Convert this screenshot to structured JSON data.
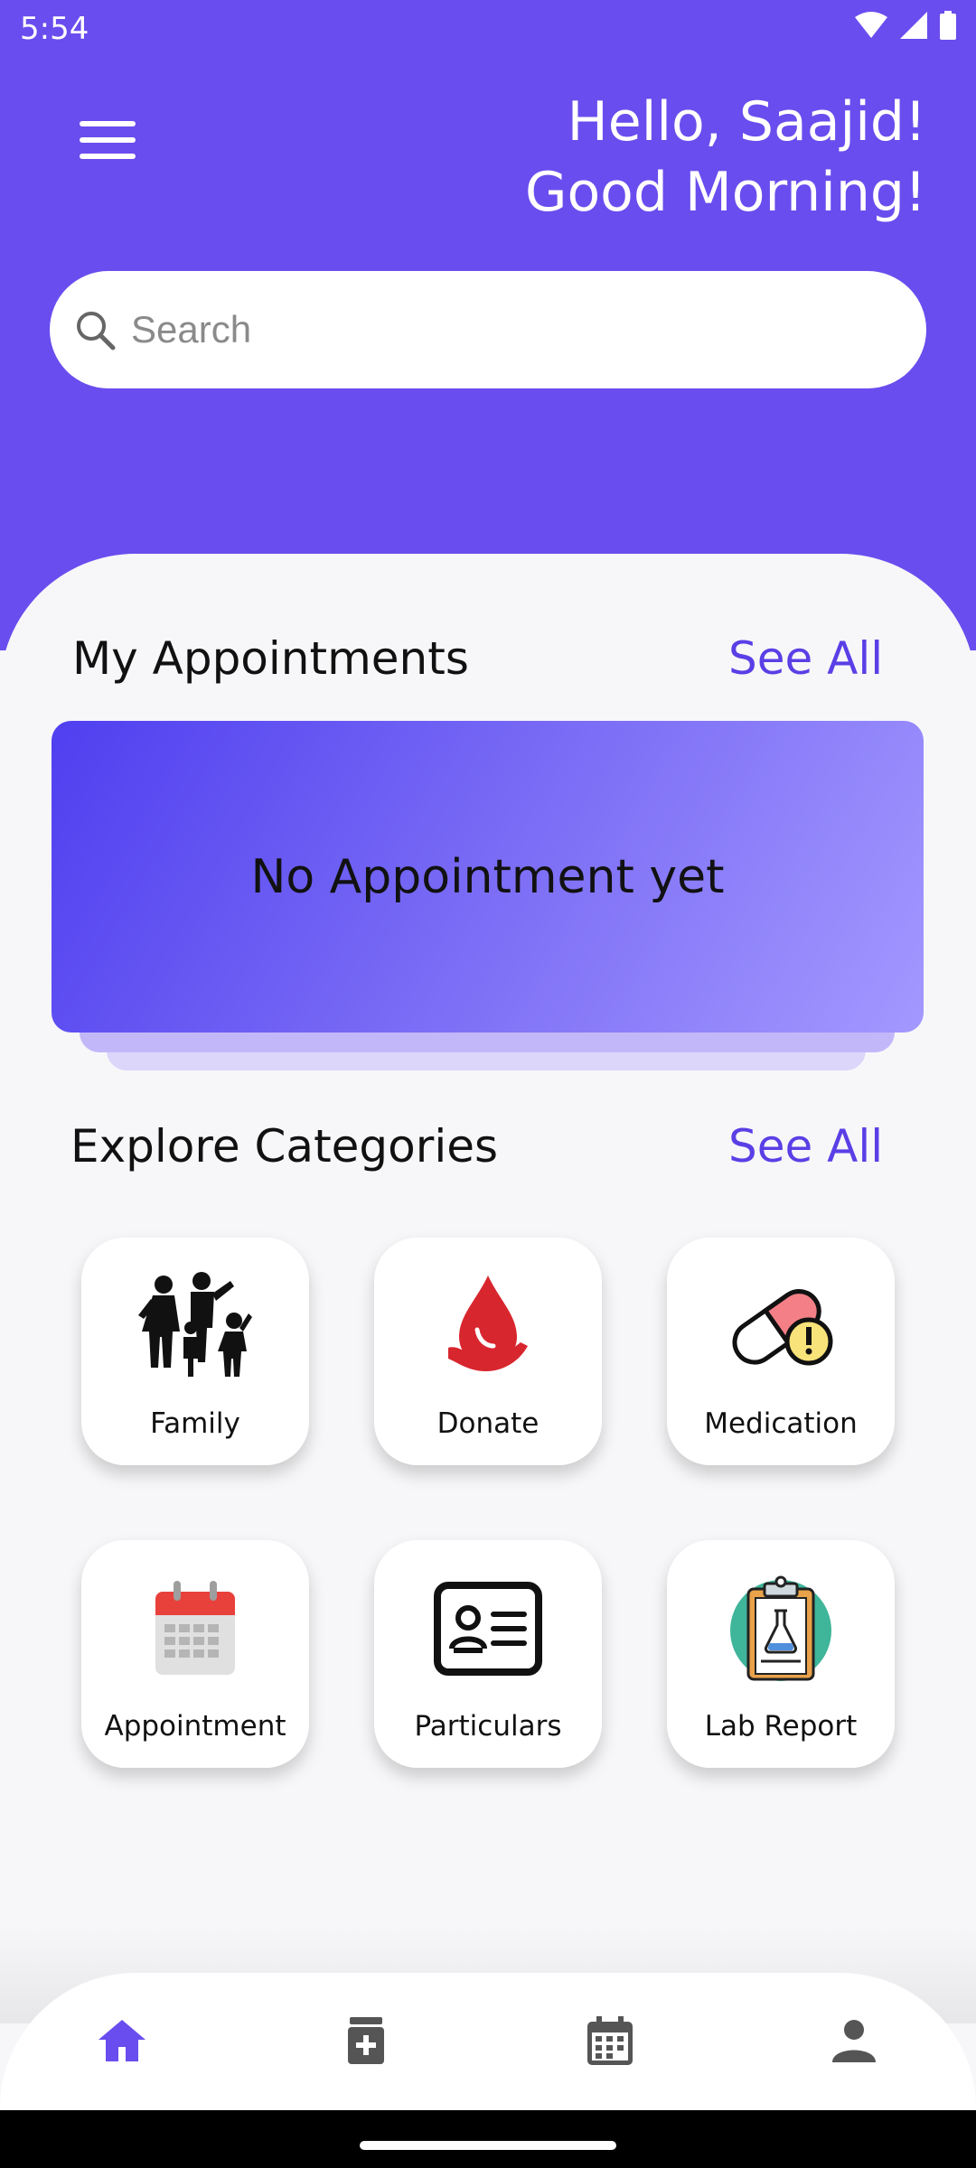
{
  "status_bar": {
    "time": "5:54"
  },
  "header": {
    "greeting_line1": "Hello, Saajid!",
    "greeting_line2": "Good Morning!",
    "background_color": "#6a4dee"
  },
  "search": {
    "placeholder": "Search"
  },
  "appointments": {
    "title": "My Appointments",
    "see_all": "See All",
    "empty_message": "No Appointment yet"
  },
  "categories": {
    "title": "Explore Categories",
    "see_all": "See All",
    "items": [
      {
        "label": "Family",
        "icon": "family-icon"
      },
      {
        "label": "Donate",
        "icon": "blood-donate-icon"
      },
      {
        "label": "Medication",
        "icon": "pill-icon"
      },
      {
        "label": "Appointment",
        "icon": "calendar-icon"
      },
      {
        "label": "Particulars",
        "icon": "id-card-icon"
      },
      {
        "label": "Lab Report",
        "icon": "lab-report-icon"
      }
    ]
  },
  "bottom_nav": {
    "items": [
      {
        "name": "home",
        "icon": "home-icon",
        "active": true
      },
      {
        "name": "medicine",
        "icon": "medicine-icon",
        "active": false
      },
      {
        "name": "calendar",
        "icon": "calendar-icon",
        "active": false
      },
      {
        "name": "profile",
        "icon": "person-icon",
        "active": false
      }
    ],
    "active_color": "#6a4dee",
    "inactive_color": "#555555"
  },
  "colors": {
    "accent": "#5a3fe6",
    "brand": "#6a4dee"
  }
}
